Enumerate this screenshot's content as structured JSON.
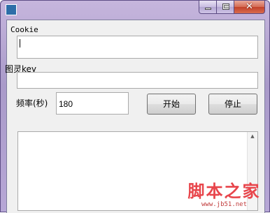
{
  "window": {
    "title": "",
    "controls": {
      "minimize": "minimize",
      "maximize": "maximize",
      "close": "✕"
    }
  },
  "form": {
    "cookie_label": "Cookie",
    "cookie_value": "",
    "key_label": "图灵key",
    "key_value": "",
    "frequency_label": "频率(秒)",
    "frequency_value": "180",
    "start_button": "开始",
    "stop_button": "停止",
    "log_text": ""
  },
  "watermark": {
    "text": "脚本之家",
    "url": "www.jb51.net"
  },
  "colors": {
    "title_bar": "#b7a7d6",
    "client_background": "#f0f0f0",
    "close_button": "#c2412a",
    "watermark": "#e8454b"
  }
}
